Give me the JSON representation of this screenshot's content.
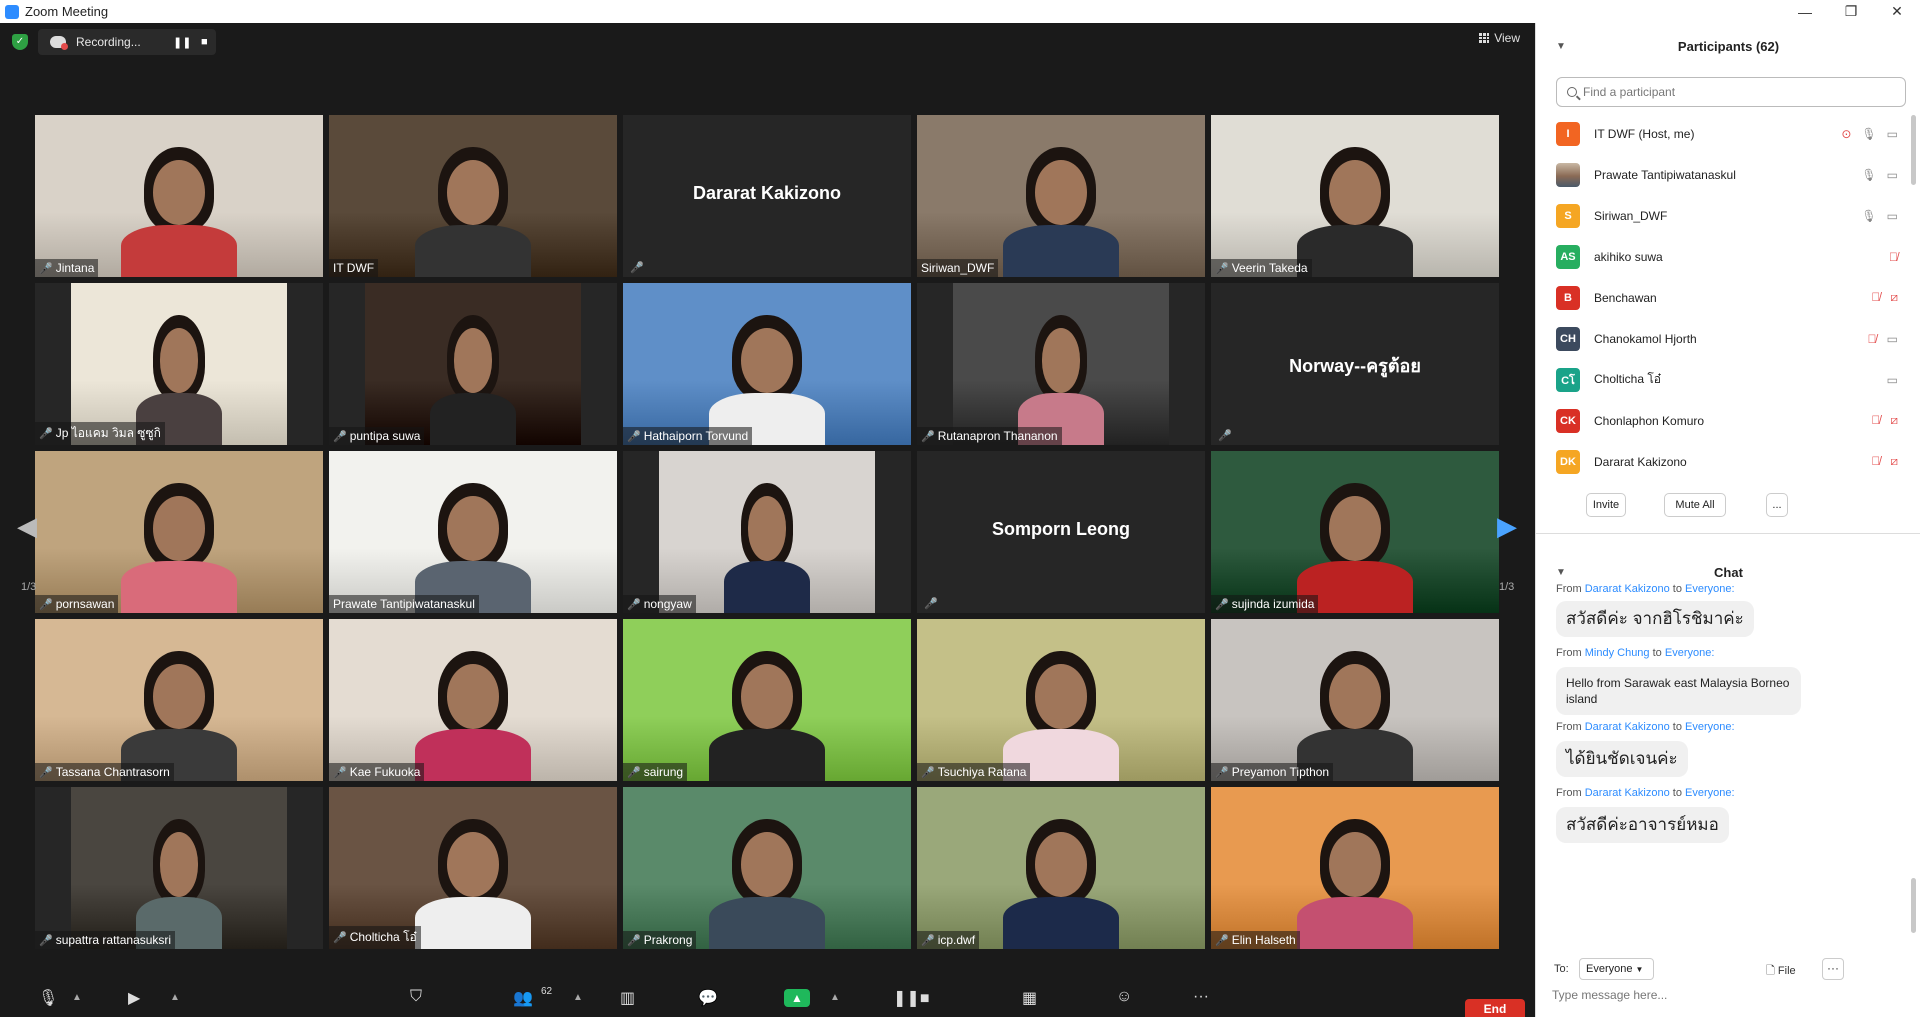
{
  "window": {
    "title": "Zoom Meeting",
    "minimize": "—",
    "restore": "❐",
    "close": "✕"
  },
  "topbar": {
    "recording_label": "Recording...",
    "pause": "❚❚",
    "stop": "■",
    "view_label": "View"
  },
  "tiles": [
    {
      "name": "Jintana",
      "muted": true,
      "video": true
    },
    {
      "name": "IT DWF",
      "muted": false,
      "video": true
    },
    {
      "name": "Dararat Kakizono",
      "muted": true,
      "video": false
    },
    {
      "name": "Siriwan_DWF",
      "muted": false,
      "video": true
    },
    {
      "name": "Veerin Takeda",
      "muted": true,
      "video": true
    },
    {
      "name": "Jp ไอแคม วิมล ซูซูกิ",
      "muted": true,
      "video": true
    },
    {
      "name": "puntipa suwa",
      "muted": true,
      "video": true
    },
    {
      "name": "Hathaiporn Torvund",
      "muted": true,
      "video": true
    },
    {
      "name": "Rutanapron Thananon",
      "muted": true,
      "video": true
    },
    {
      "name": "Norway--ครูต้อย",
      "muted": true,
      "video": false
    },
    {
      "name": "pornsawan",
      "muted": true,
      "video": true
    },
    {
      "name": "Prawate Tantipiwatanaskul",
      "muted": false,
      "video": true
    },
    {
      "name": "nongyaw",
      "muted": true,
      "video": true
    },
    {
      "name": "Somporn Leong",
      "muted": true,
      "video": false
    },
    {
      "name": "sujinda izumida",
      "muted": true,
      "video": true
    },
    {
      "name": "Tassana Chantrasorn",
      "muted": true,
      "video": true
    },
    {
      "name": "Kae Fukuoka",
      "muted": true,
      "video": true
    },
    {
      "name": "sairung",
      "muted": true,
      "video": true
    },
    {
      "name": "Tsuchiya Ratana",
      "muted": true,
      "video": true
    },
    {
      "name": "Preyamon Tipthon",
      "muted": true,
      "video": true
    },
    {
      "name": "supattra rattanasuksri",
      "muted": true,
      "video": true
    },
    {
      "name": "Cholticha โอ๋",
      "muted": true,
      "video": true
    },
    {
      "name": "Prakrong",
      "muted": true,
      "video": true
    },
    {
      "name": "icp.dwf",
      "muted": true,
      "video": true
    },
    {
      "name": "Elin Halseth",
      "muted": true,
      "video": true
    }
  ],
  "pagination": {
    "prev": "1/3",
    "next": "1/3"
  },
  "toolbar": {
    "participant_count": "62",
    "end_label": "End"
  },
  "participants_panel": {
    "title": "Participants (62)",
    "search_placeholder": "Find a participant",
    "items": [
      {
        "initials": "I",
        "name": "IT DWF (Host, me)",
        "color": "#f26522",
        "mic_muted": false,
        "vid_off": false,
        "recording": true
      },
      {
        "initials": "",
        "name": "Prawate Tantipiwatanaskul",
        "color": "#7a6a5a",
        "mic_muted": false,
        "vid_off": false,
        "recording": false,
        "photo": true
      },
      {
        "initials": "S",
        "name": "Siriwan_DWF",
        "color": "#f5a623",
        "mic_muted": false,
        "vid_off": false,
        "recording": false
      },
      {
        "initials": "AS",
        "name": "akihiko suwa",
        "color": "#27ae60",
        "mic_muted": true,
        "vid_off": null,
        "recording": false
      },
      {
        "initials": "B",
        "name": "Benchawan",
        "color": "#d93025",
        "mic_muted": true,
        "vid_off": true,
        "recording": false
      },
      {
        "initials": "CH",
        "name": "Chanokamol Hjorth",
        "color": "#3c4a5e",
        "mic_muted": true,
        "vid_off": false,
        "recording": false
      },
      {
        "initials": "Cโ",
        "name": "Cholticha โอ๋",
        "color": "#1aa389",
        "mic_muted": false,
        "vid_off": false,
        "recording": false,
        "no_mic": true
      },
      {
        "initials": "CK",
        "name": "Chonlaphon Komuro",
        "color": "#d93025",
        "mic_muted": true,
        "vid_off": true,
        "recording": false
      },
      {
        "initials": "DK",
        "name": "Dararat Kakizono",
        "color": "#f5a623",
        "mic_muted": true,
        "vid_off": true,
        "recording": false
      }
    ],
    "invite_label": "Invite",
    "mute_all_label": "Mute All",
    "more_label": "..."
  },
  "chat_panel": {
    "title": "Chat",
    "from_label": "From",
    "to_label": "to",
    "messages": [
      {
        "from": "Dararat Kakizono",
        "to": "Everyone:",
        "text": "สวัสดีค่ะ จากฮิโรชิมาค่ะ"
      },
      {
        "from": "Mindy Chung",
        "to": "Everyone:",
        "text": "Hello from Sarawak east Malaysia Borneo island"
      },
      {
        "from": "Dararat Kakizono",
        "to": "Everyone:",
        "text": "ได้ยินชัดเจนค่ะ"
      },
      {
        "from": "Dararat Kakizono",
        "to": "Everyone:",
        "text": "สวัสดีค่ะอาจารย์หมอ"
      }
    ],
    "to_prefix": "To:",
    "to_value": "Everyone",
    "file_label": "File",
    "more_label": "···",
    "input_placeholder": "Type message here..."
  },
  "colors": {
    "meeting_bg": "#1a1a1a",
    "active_speaker": "#d3e06b",
    "muted_red": "#e34b4b",
    "link_blue": "#2d8cff",
    "end_red": "#d93025",
    "share_green": "#1fb85b"
  }
}
